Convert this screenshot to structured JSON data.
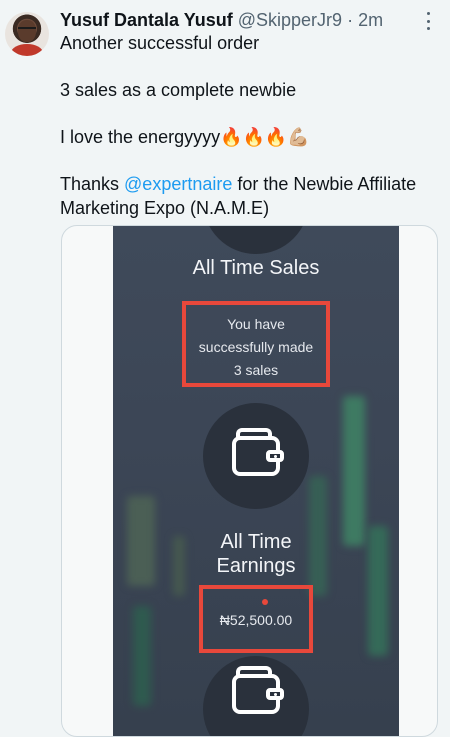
{
  "tweet": {
    "author_name": "Yusuf Dantala Yusuf",
    "handle": "@SkipperJr9",
    "separator": "·",
    "time": "2m",
    "line1": "Another successful order",
    "line2": "3 sales as a complete newbie",
    "line3": "I love the energyyyy🔥🔥🔥💪🏼",
    "line4_prefix": "Thanks ",
    "mention": "@expertnaire",
    "line4_suffix": " for the Newbie Affiliate Marketing Expo (N.A.M.E)"
  },
  "screenshot": {
    "sales_title": "All Time Sales",
    "sales_line1": "You have",
    "sales_line2": "successfully made",
    "sales_line3": "3 sales",
    "earnings_title_line1": "All Time",
    "earnings_title_line2": "Earnings",
    "earnings_value": "₦52,500.00"
  },
  "icons": {
    "more": "more-vertical-icon",
    "wallet": "wallet-icon"
  },
  "colors": {
    "mention": "#1d9bf0",
    "highlight": "#e8483b",
    "muted": "#536471"
  }
}
